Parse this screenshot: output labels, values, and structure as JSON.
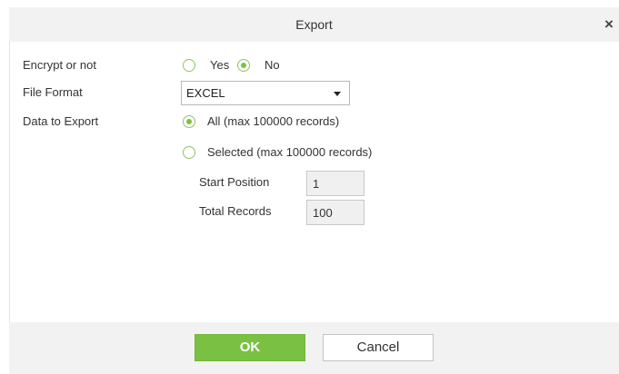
{
  "dialog": {
    "title": "Export",
    "close_label": "×"
  },
  "form": {
    "encrypt": {
      "label": "Encrypt or not",
      "options": [
        {
          "label": "Yes",
          "selected": false
        },
        {
          "label": "No",
          "selected": true
        }
      ]
    },
    "file_format": {
      "label": "File Format",
      "value": "EXCEL"
    },
    "data_to_export": {
      "label": "Data to Export",
      "options": [
        {
          "label": "All (max 100000 records)",
          "selected": true
        },
        {
          "label": "Selected (max 100000 records)",
          "selected": false
        }
      ],
      "start_position": {
        "label": "Start Position",
        "value": "1"
      },
      "total_records": {
        "label": "Total Records",
        "value": "100"
      }
    }
  },
  "buttons": {
    "ok_label": "OK",
    "cancel_label": "Cancel"
  },
  "colors": {
    "accent": "#7ac143",
    "header_background": "#f2f2f2"
  }
}
